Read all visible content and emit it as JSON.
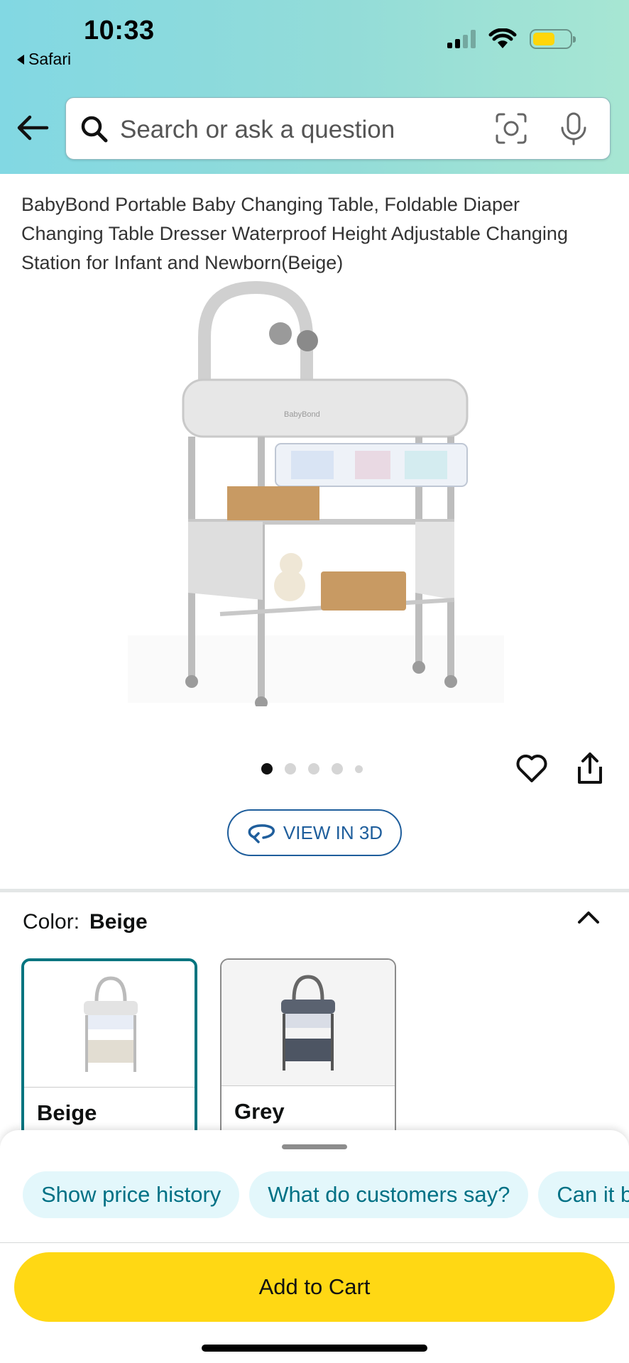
{
  "status_bar": {
    "time": "10:33",
    "back_app": "Safari"
  },
  "search": {
    "placeholder": "Search or ask a question"
  },
  "product": {
    "title": "BabyBond Portable Baby Changing Table, Foldable Diaper Changing Table Dresser Waterproof Height Adjustable Changing Station for Infant and Newborn(Beige)",
    "image_brand_label": "BabyBond",
    "image_count": 5,
    "active_image_index": 0
  },
  "view3d": {
    "label": "VIEW IN 3D"
  },
  "color": {
    "label": "Color:",
    "selected": "Beige",
    "options": [
      {
        "name": "Beige"
      },
      {
        "name": "Grey"
      }
    ]
  },
  "sheet": {
    "chips": [
      "Show price history",
      "What do customers say?",
      "Can it b"
    ],
    "add_to_cart": "Add to Cart"
  },
  "colors": {
    "accent_teal": "#00747f",
    "link_blue": "#1f5e9c",
    "cart_yellow": "#ffd814",
    "chip_bg": "#e3f7fb",
    "battery_yellow": "#ffd60a"
  }
}
